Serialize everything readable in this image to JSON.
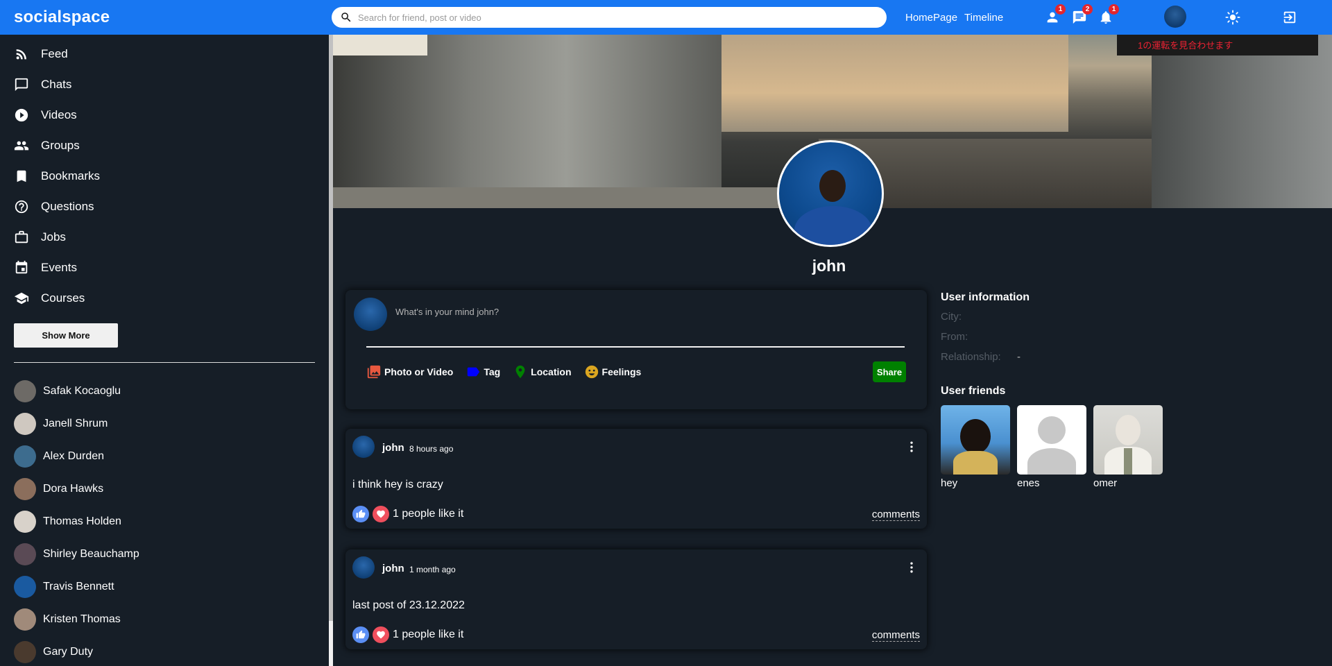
{
  "app": {
    "logo": "socialspace"
  },
  "search": {
    "placeholder": "Search for friend, post or video"
  },
  "nav_links": [
    "HomePage",
    "Timeline"
  ],
  "notifications": {
    "friends": "1",
    "messages": "2",
    "alerts": "1"
  },
  "sidebar": {
    "menu": [
      {
        "label": "Feed",
        "icon": "rss-icon"
      },
      {
        "label": "Chats",
        "icon": "chat-icon"
      },
      {
        "label": "Videos",
        "icon": "play-circle-icon"
      },
      {
        "label": "Groups",
        "icon": "groups-icon"
      },
      {
        "label": "Bookmarks",
        "icon": "bookmark-icon"
      },
      {
        "label": "Questions",
        "icon": "help-icon"
      },
      {
        "label": "Jobs",
        "icon": "briefcase-icon"
      },
      {
        "label": "Events",
        "icon": "calendar-icon"
      },
      {
        "label": "Courses",
        "icon": "school-icon"
      }
    ],
    "show_more": "Show More",
    "friends": [
      {
        "name": "Safak Kocaoglu",
        "color": "#6d6a66"
      },
      {
        "name": "Janell Shrum",
        "color": "#cfc8c0"
      },
      {
        "name": "Alex Durden",
        "color": "#3d6c8e"
      },
      {
        "name": "Dora Hawks",
        "color": "#8b6e5c"
      },
      {
        "name": "Thomas Holden",
        "color": "#d8d2ca"
      },
      {
        "name": "Shirley Beauchamp",
        "color": "#5a4a55"
      },
      {
        "name": "Travis Bennett",
        "color": "#1a5aa0"
      },
      {
        "name": "Kristen Thomas",
        "color": "#a08a7a"
      },
      {
        "name": "Gary Duty",
        "color": "#4a3a2e"
      }
    ]
  },
  "cover": {
    "sign_text": "1の運転を見合わせます"
  },
  "profile": {
    "name": "john"
  },
  "share": {
    "placeholder": "What's in your mind john?",
    "options": [
      "Photo or Video",
      "Tag",
      "Location",
      "Feelings"
    ],
    "button": "Share"
  },
  "posts": [
    {
      "user": "john",
      "date": "8 hours ago",
      "text": "i think hey is crazy",
      "likes": "1 people like it",
      "comments": "comments"
    },
    {
      "user": "john",
      "date": "1 month ago",
      "text": "last post of 23.12.2022",
      "likes": "1 people like it",
      "comments": "comments"
    }
  ],
  "user_info": {
    "title": "User information",
    "rows": [
      {
        "key": "City:",
        "value": ""
      },
      {
        "key": "From:",
        "value": ""
      },
      {
        "key": "Relationship:",
        "value": "-"
      }
    ]
  },
  "user_friends": {
    "title": "User friends",
    "items": [
      {
        "name": "hey"
      },
      {
        "name": "enes"
      },
      {
        "name": "omer"
      }
    ]
  },
  "colors": {
    "brand": "#1877f2",
    "background": "#161e27",
    "share": "#008000",
    "badge": "#e4252d"
  }
}
